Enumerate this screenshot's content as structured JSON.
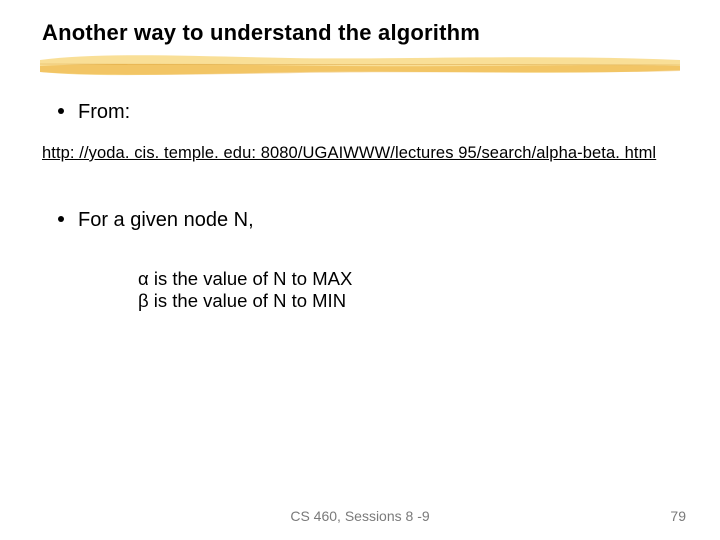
{
  "title": "Another way to understand the algorithm",
  "bullets": {
    "from": "From:",
    "node": "For a given node N,"
  },
  "link": "http: //yoda. cis. temple. edu: 8080/UGAIWWW/lectures 95/search/alpha-beta. html",
  "sub": {
    "alpha": "α is the value of N to MAX",
    "beta": "β is the value of N to MIN"
  },
  "footer": {
    "center": "CS 460,  Sessions 8 -9",
    "page": "79"
  }
}
